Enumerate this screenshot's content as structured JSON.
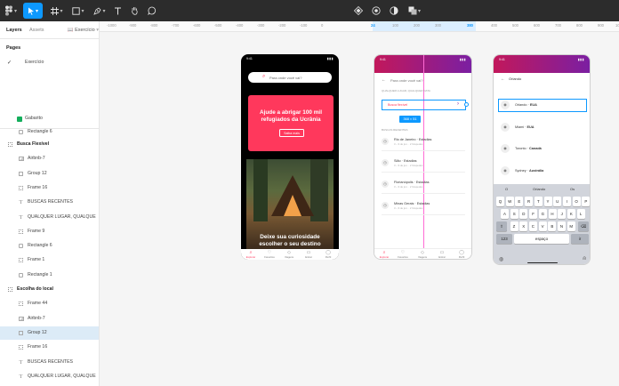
{
  "toolbar": {
    "icons": [
      "figma-menu-icon",
      "move-tool-icon",
      "frame-tool-icon",
      "shape-tool-icon",
      "pen-tool-icon",
      "text-tool-icon",
      "hand-tool-icon",
      "comment-tool-icon",
      "component-icon",
      "mask-icon",
      "contrast-icon",
      "boolean-icon"
    ],
    "active_tool": "move-tool-icon"
  },
  "left_panel": {
    "tabs": [
      "Layers",
      "Assets"
    ],
    "page_picker": "Exercício",
    "pages_title": "Pages",
    "pages": [
      {
        "name": "Exercício",
        "checked": true
      },
      {
        "name": "Gabarito",
        "checked": false
      }
    ],
    "layers": [
      {
        "label": "Rectangle 6",
        "icon": "rect",
        "indent": 2
      },
      {
        "label": "Busca Flexível",
        "icon": "grid",
        "indent": 1,
        "bold": true
      },
      {
        "label": "Airbnb-7",
        "icon": "image",
        "indent": 2
      },
      {
        "label": "Group 12",
        "icon": "frame",
        "indent": 2
      },
      {
        "label": "Frame 16",
        "icon": "grid",
        "indent": 2
      },
      {
        "label": "BUSCAS RECENTES",
        "icon": "text",
        "indent": 2
      },
      {
        "label": "QUALQUER LUGAR, QUALQUE",
        "icon": "text",
        "indent": 2
      },
      {
        "label": "Frame 9",
        "icon": "grid",
        "indent": 2
      },
      {
        "label": "Rectangle 6",
        "icon": "rect",
        "indent": 2
      },
      {
        "label": "Frame 1",
        "icon": "grid",
        "indent": 2
      },
      {
        "label": "Rectangle 1",
        "icon": "rect",
        "indent": 2
      },
      {
        "label": "Escolha do local",
        "icon": "grid",
        "indent": 1,
        "bold": true
      },
      {
        "label": "Frame 44",
        "icon": "grid",
        "indent": 2
      },
      {
        "label": "Airbnb-7",
        "icon": "image",
        "indent": 2
      },
      {
        "label": "Group 12",
        "icon": "frame",
        "indent": 2,
        "selected": true
      },
      {
        "label": "Frame 16",
        "icon": "grid",
        "indent": 2
      },
      {
        "label": "BUSCAS RECENTES",
        "icon": "text",
        "indent": 2
      },
      {
        "label": "QUALQUER LUGAR, QUALQUE",
        "icon": "text",
        "indent": 2
      }
    ]
  },
  "ruler": {
    "ticks": [
      "-1000",
      "-900",
      "-800",
      "-700",
      "-600",
      "-500",
      "-400",
      "-300",
      "-200",
      "-100",
      "0",
      "24",
      "100",
      "200",
      "300",
      "380",
      "400",
      "500",
      "600",
      "700",
      "800",
      "900",
      "1000"
    ],
    "highlight_start": "24",
    "highlight_end": "380"
  },
  "phone1": {
    "status_time": "9:41",
    "search_placeholder": "Para onde você vai?",
    "card_title": "Ajude a abrigar 100 mil refugiados da Ucrânia",
    "card_button": "Saiba mais",
    "image_caption": "Deixe sua curiosidade escolher o seu destino",
    "nav": [
      "Explorar",
      "Favoritos",
      "Viagens",
      "Entrar",
      "Perfil"
    ]
  },
  "phone2": {
    "status_time": "9:41",
    "search_placeholder": "Para onde você vai?",
    "subheading": "QUALQUER LUGAR, QUALQUER DATA",
    "selected_item": "Busca flexível",
    "dimension_tag": "368 × 51",
    "recent_heading": "BUSCAS RECENTES",
    "recent": [
      {
        "city": "Rio de Janeiro · Estadias",
        "sub": "3 – 9 de jun. · 2 hóspedes"
      },
      {
        "city": "Sião · Estadias",
        "sub": "3 – 9 de jun. · 2 hóspedes"
      },
      {
        "city": "Florianópolis · Estadias",
        "sub": "3 – 9 de jun. · 2 hóspedes"
      },
      {
        "city": "Minas Gerais · Estadias",
        "sub": "3 – 9 de jun. · 2 hóspedes"
      }
    ],
    "nav": [
      "Explorar",
      "Favoritos",
      "Viagens",
      "Entrar",
      "Perfil"
    ]
  },
  "phone3": {
    "status_time": "9:41",
    "header": "Orlando",
    "cities": [
      {
        "name": "Orlando",
        "country": "EUA"
      },
      {
        "name": "Miami",
        "country": "EUA"
      },
      {
        "name": "Toronto",
        "country": "Canadá"
      },
      {
        "name": "Sydney",
        "country": "Austrália"
      }
    ],
    "suggestions": [
      "O",
      "Orlando",
      "Os"
    ],
    "row1": [
      "Q",
      "W",
      "E",
      "R",
      "T",
      "Y",
      "U",
      "I",
      "O",
      "P"
    ],
    "row2": [
      "A",
      "S",
      "D",
      "F",
      "G",
      "H",
      "J",
      "K",
      "L"
    ],
    "row3": [
      "Z",
      "X",
      "C",
      "V",
      "B",
      "N",
      "M"
    ],
    "shift": "⇧",
    "backspace": "⌫",
    "num_key": "123",
    "space": "espaço",
    "return": "ir"
  },
  "colors": {
    "accent": "#0d99ff",
    "brand": "#ff385c",
    "gradient_start": "#c2185b",
    "gradient_end": "#7b1fa2",
    "toolbar": "#2c2c2c"
  }
}
